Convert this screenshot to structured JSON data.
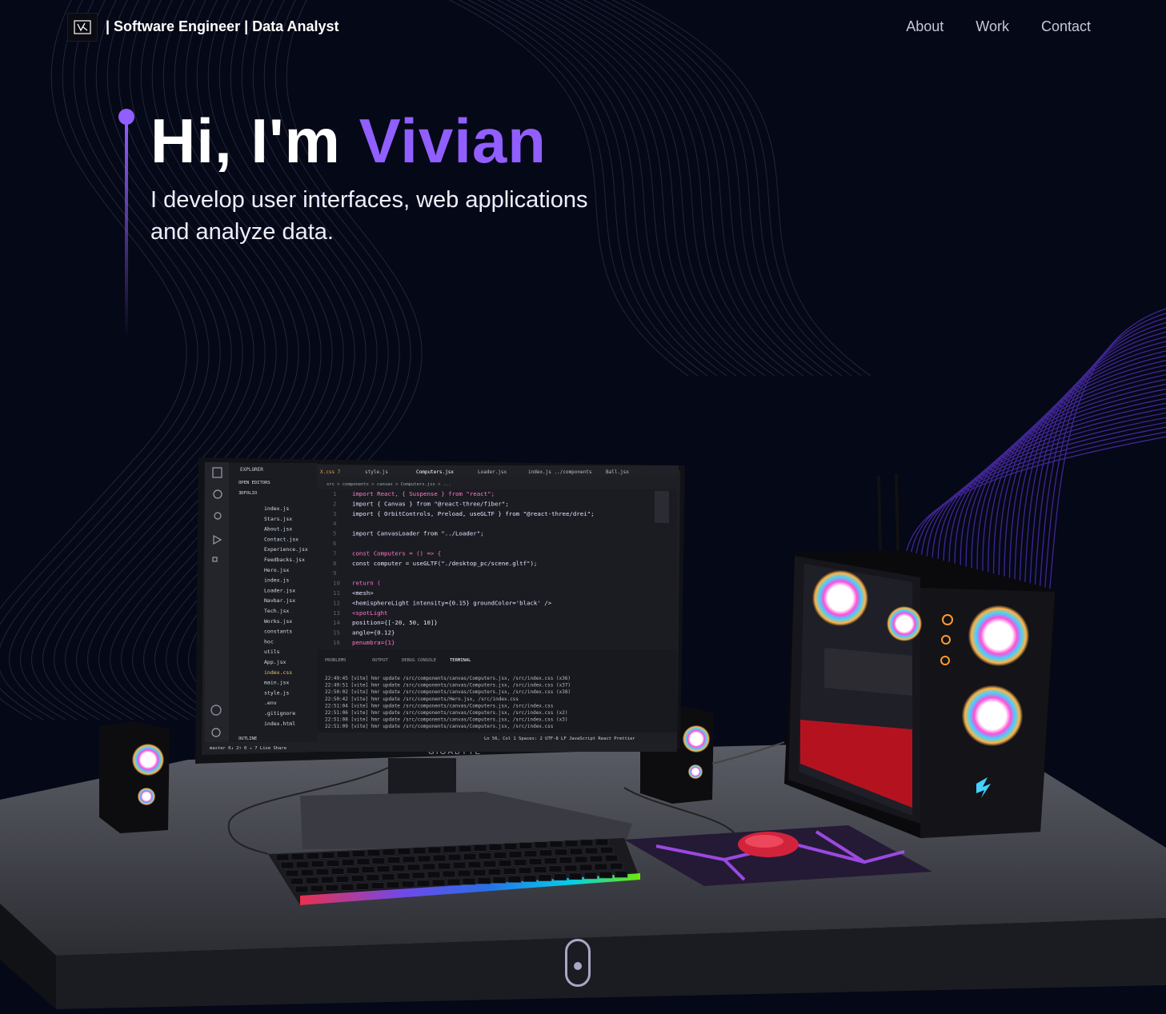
{
  "nav": {
    "logo_icon": "vk-monogram-logo",
    "brand": "| Software Engineer | Data Analyst",
    "links": [
      "About",
      "Work",
      "Contact"
    ]
  },
  "hero": {
    "greeting": "Hi, I'm ",
    "name": "Vivian",
    "subtitle_line1": "I develop user interfaces, web applications",
    "subtitle_line2": "and analyze data."
  },
  "colors": {
    "accent": "#915eff",
    "background": "#050816",
    "nav_text": "#c7c7d6"
  },
  "editor": {
    "tabs": [
      "X.css 7",
      "style.js",
      "Computers.jsx",
      "Loader.jsx",
      "index.js ../components",
      "Ball.jsx"
    ],
    "breadcrumb": "src > components > canvas > Computers.jsx > ...",
    "explorer_title": "EXPLORER",
    "open_editors": "OPEN EDITORS",
    "project": "3DFOLIO",
    "files": [
      "index.js",
      "Stars.jsx",
      "About.jsx",
      "Contact.jsx",
      "Experience.jsx",
      "Feedbacks.jsx",
      "Hero.jsx",
      "index.js",
      "Loader.jsx",
      "Navbar.jsx",
      "Tech.jsx",
      "Works.jsx",
      "constants",
      "hoc",
      "utils",
      "App.jsx",
      "index.css",
      "main.jsx",
      "style.js",
      ".env",
      ".gitignore",
      "index.html"
    ],
    "code_lines": [
      "import React, { Suspense } from \"react\";",
      "import { Canvas } from \"@react-three/fiber\";",
      "import { OrbitControls, Preload, useGLTF } from \"@react-three/drei\";",
      "",
      "import CanvasLoader from \"../Loader\";",
      "",
      "const Computers = () => {",
      "  const computer = useGLTF(\"./desktop_pc/scene.gltf\");",
      "",
      "  return (",
      "    <mesh>",
      "      <hemisphereLight intensity={0.15} groundColor='black' />",
      "      <spotLight",
      "        position={[-20, 50, 10]}",
      "        angle={0.12}",
      "        penumbra={1}"
    ],
    "panel_tabs": [
      "PROBLEMS",
      "OUTPUT",
      "DEBUG CONSOLE",
      "TERMINAL"
    ],
    "terminal_lines": [
      "22:49:45 [vite] hmr update /src/components/canvas/Computers.jsx, /src/index.css (x36)",
      "22:49:51 [vite] hmr update /src/components/canvas/Computers.jsx, /src/index.css (x37)",
      "22:50:02 [vite] hmr update /src/components/canvas/Computers.jsx, /src/index.css (x38)",
      "22:50:42 [vite] hmr update /src/components/Hero.jsx, /src/index.css",
      "22:51:04 [vite] hmr update /src/components/canvas/Computers.jsx, /src/index.css",
      "22:51:06 [vite] hmr update /src/components/canvas/Computers.jsx, /src/index.css (x2)",
      "22:51:08 [vite] hmr update /src/components/canvas/Computers.jsx, /src/index.css (x3)",
      "22:51:09 [vite] hmr update /src/components/canvas/Computers.jsx, /src/index.css"
    ],
    "status_left": "master  0↓ 2↑  0 ⚠ 7  Live Share",
    "status_right": "Ln 56, Col 1  Spaces: 2  UTF-8  LF  JavaScript React  Prettier",
    "outline": "OUTLINE"
  },
  "monitor_brand": "GIGABYTE",
  "scroll_indicator_icon": "mouse-scroll-icon"
}
